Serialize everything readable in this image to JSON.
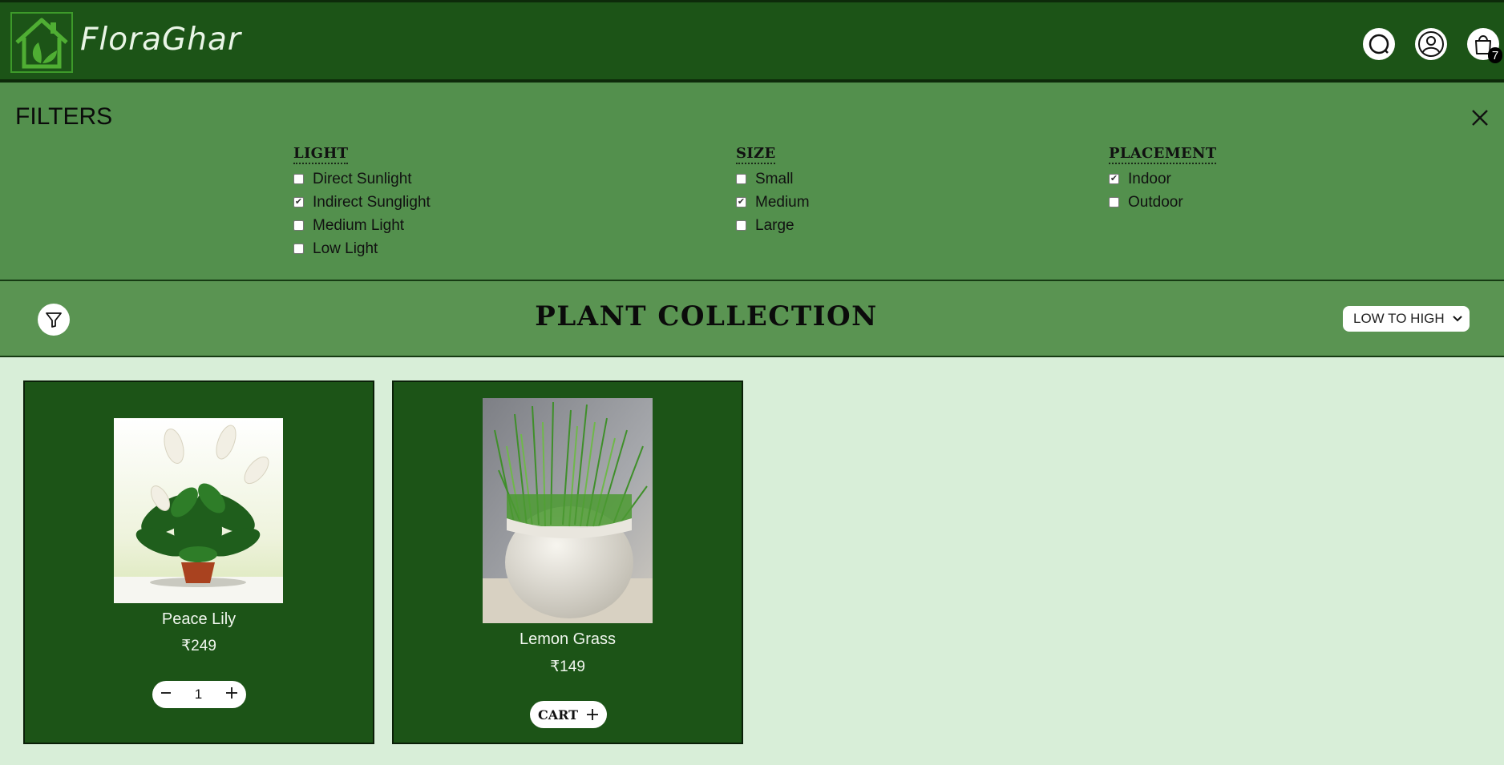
{
  "header": {
    "brand": "FloraGhar",
    "cart_count": "7",
    "icons": [
      "house-leaf-logo",
      "search-icon",
      "user-icon",
      "shopping-bag-icon"
    ]
  },
  "filters": {
    "title": "FILTERS",
    "groups": [
      {
        "title": "LIGHT",
        "options": [
          {
            "label": "Direct Sunlight",
            "checked": false
          },
          {
            "label": "Indirect Sunglight",
            "checked": true
          },
          {
            "label": "Medium Light",
            "checked": false
          },
          {
            "label": "Low Light",
            "checked": false
          }
        ]
      },
      {
        "title": "SIZE",
        "options": [
          {
            "label": "Small",
            "checked": false
          },
          {
            "label": "Medium",
            "checked": true
          },
          {
            "label": "Large",
            "checked": false
          }
        ]
      },
      {
        "title": "PLACEMENT",
        "options": [
          {
            "label": "Indoor",
            "checked": true
          },
          {
            "label": "Outdoor",
            "checked": false
          }
        ]
      }
    ]
  },
  "collection": {
    "title": "PLANT COLLECTION",
    "sort_value": "LOW TO HIGH"
  },
  "products": [
    {
      "name": "Peace Lily",
      "price": "₹249",
      "quantity": "1"
    },
    {
      "name": "Lemon Grass",
      "price": "₹149",
      "cart_label": "CART"
    }
  ],
  "colors": {
    "header_bg": "#1c5417",
    "filter_bg": "#53904d",
    "page_bg": "#d8eed8",
    "card_bg": "#1c5417"
  }
}
